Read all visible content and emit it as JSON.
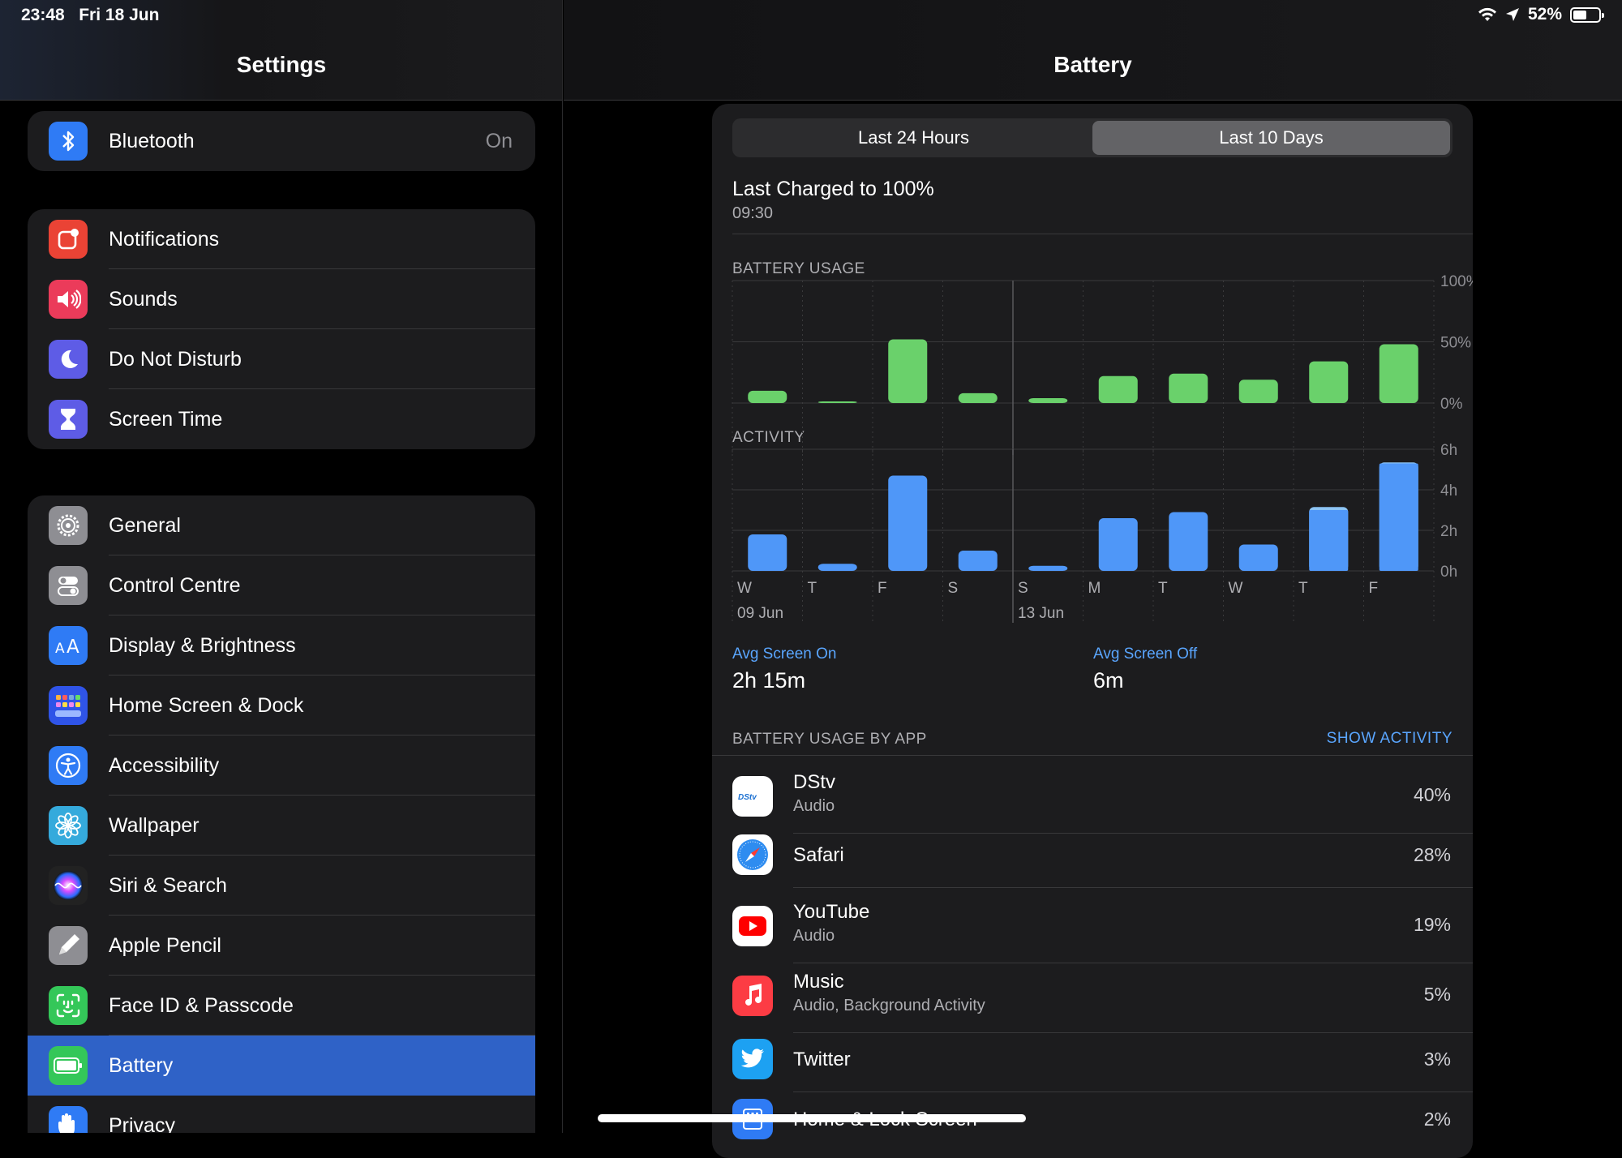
{
  "status_bar": {
    "time": "23:48",
    "date": "Fri 18 Jun",
    "battery_percent": "52%"
  },
  "sidebar": {
    "title": "Settings",
    "groups": [
      [
        {
          "label": "Bluetooth",
          "value": "On",
          "icon": "bluetooth-icon",
          "color": "#2f7bf5"
        }
      ],
      [
        {
          "label": "Notifications",
          "icon": "notifications-icon",
          "color": "#ea4335"
        },
        {
          "label": "Sounds",
          "icon": "speaker-icon",
          "color": "#eb3b5a"
        },
        {
          "label": "Do Not Disturb",
          "icon": "moon-icon",
          "color": "#5e5ce6"
        },
        {
          "label": "Screen Time",
          "icon": "hourglass-icon",
          "color": "#5e5ce6"
        }
      ],
      [
        {
          "label": "General",
          "icon": "gear-icon",
          "color": "#8e8e93"
        },
        {
          "label": "Control Centre",
          "icon": "toggles-icon",
          "color": "#8e8e93"
        },
        {
          "label": "Display & Brightness",
          "icon": "text-size-icon",
          "color": "#2f7bf5"
        },
        {
          "label": "Home Screen & Dock",
          "icon": "app-grid-icon",
          "color": "#2f54e8"
        },
        {
          "label": "Accessibility",
          "icon": "accessibility-icon",
          "color": "#2f7bf5"
        },
        {
          "label": "Wallpaper",
          "icon": "flower-icon",
          "color": "#35aadc"
        },
        {
          "label": "Siri & Search",
          "icon": "siri-icon",
          "color": "#222222"
        },
        {
          "label": "Apple Pencil",
          "icon": "pencil-icon",
          "color": "#8e8e93"
        },
        {
          "label": "Face ID & Passcode",
          "icon": "face-id-icon",
          "color": "#34c759"
        },
        {
          "label": "Battery",
          "icon": "battery-icon",
          "color": "#34c759",
          "selected": true
        },
        {
          "label": "Privacy",
          "icon": "hand-icon",
          "color": "#2f7bf5"
        }
      ]
    ]
  },
  "main": {
    "title": "Battery",
    "segments": [
      "Last 24 Hours",
      "Last 10 Days"
    ],
    "active_segment": "Last 10 Days",
    "last_charged": {
      "title": "Last Charged to 100%",
      "time": "09:30"
    },
    "battery_usage_label": "BATTERY USAGE",
    "activity_label": "ACTIVITY",
    "days": [
      "W",
      "T",
      "F",
      "S",
      "S",
      "M",
      "T",
      "W",
      "T",
      "F"
    ],
    "date_labels": [
      {
        "day_index": 0,
        "text": "09 Jun"
      },
      {
        "day_index": 4,
        "text": "13 Jun"
      }
    ],
    "avg_screen_on": {
      "label": "Avg Screen On",
      "value": "2h 15m"
    },
    "avg_screen_off": {
      "label": "Avg Screen Off",
      "value": "6m"
    },
    "usage_by_app_label": "BATTERY USAGE BY APP",
    "show_activity": "SHOW ACTIVITY",
    "apps": [
      {
        "name": "DStv",
        "sub": "Audio",
        "pct": "40%",
        "icon": "dstv-logo-icon"
      },
      {
        "name": "Safari",
        "sub": "",
        "pct": "28%",
        "icon": "compass-icon"
      },
      {
        "name": "YouTube",
        "sub": "Audio",
        "pct": "19%",
        "icon": "play-icon"
      },
      {
        "name": "Music",
        "sub": "Audio, Background Activity",
        "pct": "5%",
        "icon": "music-note-icon"
      },
      {
        "name": "Twitter",
        "sub": "",
        "pct": "3%",
        "icon": "bird-icon"
      },
      {
        "name": "Home & Lock Screen",
        "sub": "",
        "pct": "2%",
        "icon": "home-lock-icon"
      }
    ]
  },
  "chart_data": [
    {
      "type": "bar",
      "title": "BATTERY USAGE",
      "categories": [
        "W",
        "T",
        "F",
        "S",
        "S",
        "M",
        "T",
        "W",
        "T",
        "F"
      ],
      "values": [
        10,
        1,
        52,
        8,
        4,
        22,
        24,
        19,
        34,
        48
      ],
      "ylim": [
        0,
        100
      ],
      "yticks": [
        "100%",
        "50%",
        "0%"
      ],
      "bar_color": "#6ad16b"
    },
    {
      "type": "bar",
      "title": "ACTIVITY",
      "categories": [
        "W",
        "T",
        "F",
        "S",
        "S",
        "M",
        "T",
        "W",
        "T",
        "F"
      ],
      "series": [
        {
          "values": [
            1.8,
            0.35,
            4.7,
            1.0,
            0.25,
            2.6,
            2.9,
            1.3,
            3.0,
            5.3
          ],
          "color": "#4f97f8"
        },
        {
          "values": [
            0,
            0,
            0,
            0,
            0,
            0,
            0,
            0,
            0.15,
            0.05
          ],
          "color": "#8cc4f5"
        }
      ],
      "ylim": [
        0,
        6
      ],
      "yticks": [
        "6h",
        "4h",
        "2h",
        "0h"
      ]
    }
  ]
}
